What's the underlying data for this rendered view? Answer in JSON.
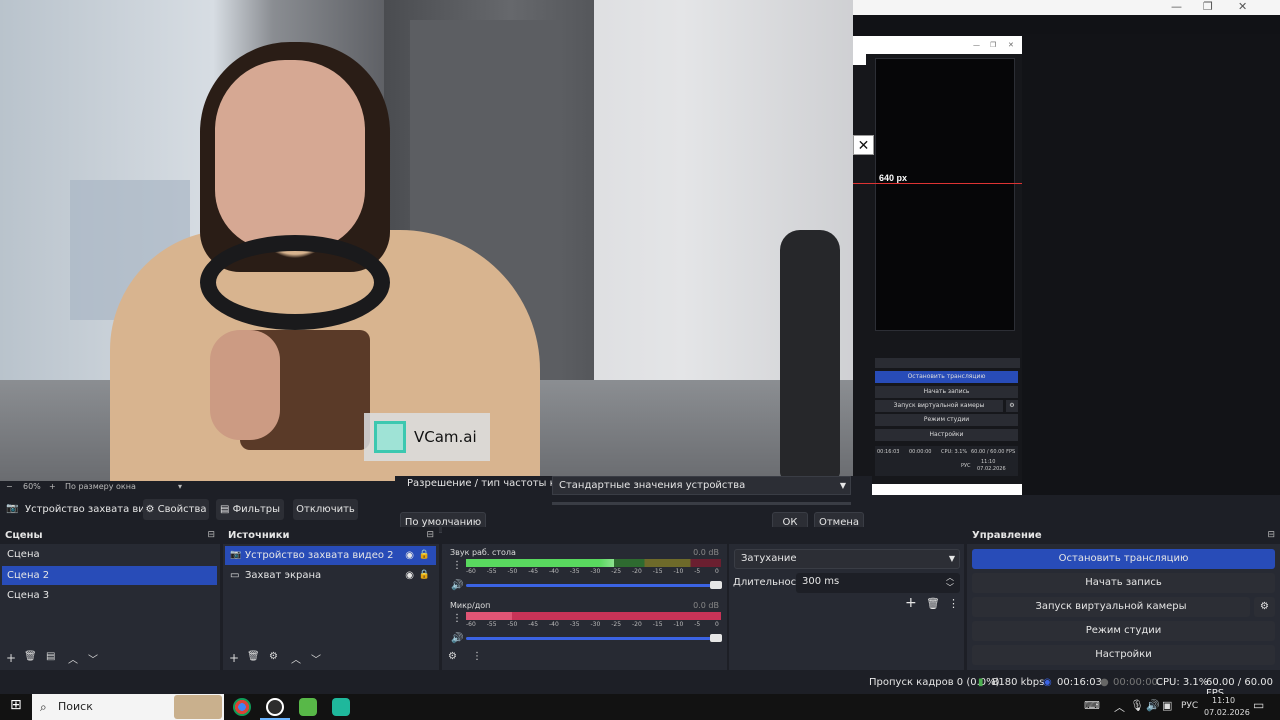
{
  "window": {
    "minimize": "—",
    "maximize": "❐",
    "close": "✕"
  },
  "preview": {
    "watermark": "VCam.ai",
    "zoom_minus": "−",
    "zoom_value": "60%",
    "zoom_plus": "+",
    "zoom_mode": "По размеру окна",
    "zoom_caret": "▾"
  },
  "nested": {
    "px_label": "640 px",
    "close": "✕",
    "buttons": [
      "Остановить трансляцию",
      "Начать запись",
      "Запуск виртуальной камеры",
      "Режим студии",
      "Настройки"
    ],
    "time": "00:16:03",
    "rec_time": "00:00:00",
    "cpu": "CPU: 3.1%",
    "fps": "60.00 / 60.00 FPS",
    "lang": "РУС",
    "clock": "11:10",
    "date": "07.02.2026"
  },
  "properties": {
    "resolution_label": "Разрешение / тип частоты кадров",
    "resolution_value": "Стандартные значения устройства",
    "defaults_button": "По умолчанию",
    "ok_button": "ОК",
    "cancel_button": "Отмена"
  },
  "source_toolbar": {
    "source_name": "Устройство захвата видео",
    "properties": "Свойства",
    "filters": "Фильтры",
    "disable": "Отключить"
  },
  "scenes": {
    "title": "Сцены",
    "items": [
      "Сцена",
      "Сцена 2",
      "Сцена 3"
    ],
    "selected_index": 1
  },
  "sources": {
    "title": "Источники",
    "items": [
      {
        "label": "Устройство захвата видео 2",
        "icon": "camera-icon"
      },
      {
        "label": "Захват экрана",
        "icon": "monitor-icon"
      }
    ]
  },
  "mixer": {
    "channels": [
      {
        "name": "Звук раб. стола",
        "db": "0.0 dB",
        "level": 0.58
      },
      {
        "name": "Микр/доп",
        "db": "0.0 dB",
        "level": 0.18
      }
    ],
    "scale": [
      "-60",
      "-55",
      "-50",
      "-45",
      "-40",
      "-35",
      "-30",
      "-25",
      "-20",
      "-15",
      "-10",
      "-5",
      "0"
    ]
  },
  "transitions": {
    "transition": "Затухание",
    "duration_label": "Длительность",
    "duration_value": "300 ms"
  },
  "controls": {
    "title": "Управление",
    "stop_stream": "Остановить трансляцию",
    "start_record": "Начать запись",
    "start_vcam": "Запуск виртуальной камеры",
    "studio_mode": "Режим студии",
    "settings": "Настройки"
  },
  "status": {
    "dropped": "Пропуск кадров 0 (0.0%)",
    "bitrate": "8180 kbps",
    "stream_time": "00:16:03",
    "rec_time": "00:00:00",
    "cpu": "CPU: 3.1%",
    "fps": "60.00 / 60.00 FPS"
  },
  "taskbar": {
    "search": "Поиск",
    "lang": "РУС",
    "time": "11:10",
    "date": "07.02.2026"
  },
  "colors": {
    "accent": "#284cb8",
    "panel": "#272a33",
    "bg": "#1d1f26",
    "meter_green": "#4caf50",
    "meter_red": "#d0345a"
  }
}
